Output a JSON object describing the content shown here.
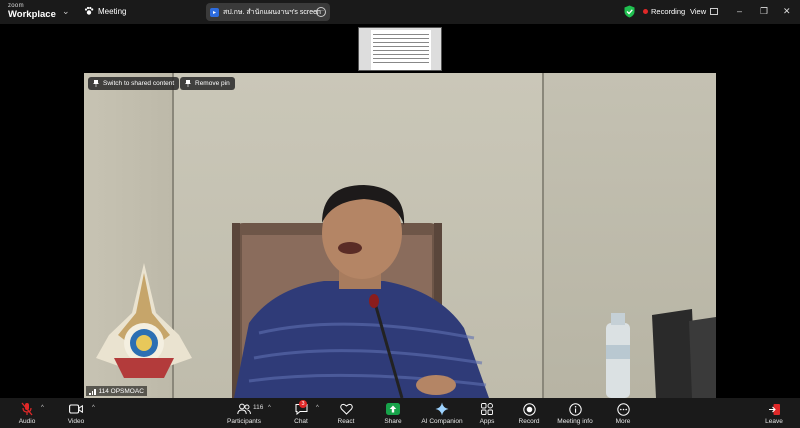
{
  "titlebar": {
    "brand_top": "zoom",
    "brand_bottom": "Workplace",
    "meeting_label": "Meeting",
    "share_label": "สป.กษ. สำนักแผนงานฯ's screen",
    "recording_label": "Recording",
    "view_label": "View"
  },
  "video": {
    "switch_label": "Switch to shared content",
    "remove_pin_label": "Remove pin",
    "participant_name": "114 OPSMOAC"
  },
  "toolbar": {
    "audio": "Audio",
    "video": "Video",
    "participants": "Participants",
    "participants_count": "116",
    "chat": "Chat",
    "chat_badge": "3",
    "react": "React",
    "share": "Share",
    "ai_companion": "AI Companion",
    "apps": "Apps",
    "record": "Record",
    "meeting_info": "Meeting info",
    "more": "More",
    "leave": "Leave"
  },
  "colors": {
    "share_green": "#17a34a",
    "recording_red": "#e02828",
    "leave_red": "#e02828",
    "shield_green": "#1fbf4f"
  }
}
